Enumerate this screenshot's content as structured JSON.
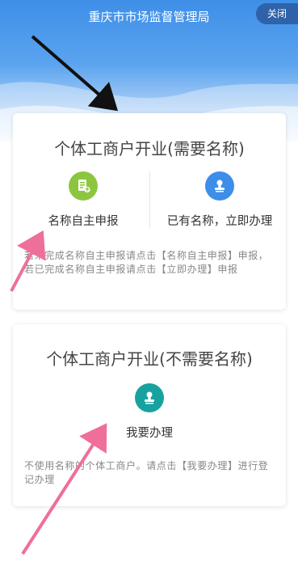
{
  "header": {
    "title": "重庆市市场监督管理局",
    "close_label": "关闭"
  },
  "cards": [
    {
      "title": "个体工商户开业(需要名称)",
      "options": [
        {
          "label": "名称自主申报",
          "icon": "document-upload-icon",
          "color": "#8cc63f"
        },
        {
          "label": "已有名称，立即办理",
          "icon": "stamp-icon",
          "color": "#3c8ee8"
        }
      ],
      "description": "若未完成名称自主申报请点击【名称自主申报】申报，若已完成名称自主申报请点击【立即办理】申报"
    },
    {
      "title": "个体工商户开业(不需要名称)",
      "options": [
        {
          "label": "我要办理",
          "icon": "stamp-icon",
          "color": "#17a2a0"
        }
      ],
      "description": "不使用名称的个体工商户。请点击【我要办理】进行登记办理"
    }
  ],
  "annotations": {
    "black_arrow_color": "#111111",
    "pink_arrow_color": "#ee6f9a"
  }
}
